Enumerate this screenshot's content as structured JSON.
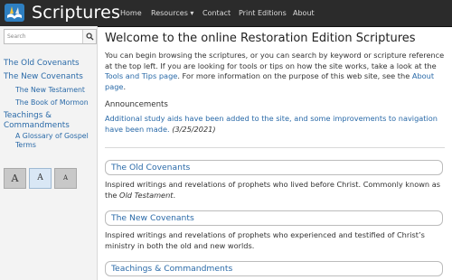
{
  "header": {
    "brand": "Scriptures",
    "nav": [
      "Home",
      "Resources ▾",
      "Contact",
      "Print Editions",
      "About"
    ]
  },
  "sidebar": {
    "search_placeholder": "Search",
    "items": [
      {
        "label": "The Old Covenants"
      },
      {
        "label": "The New Covenants"
      },
      {
        "label": "The New Testament"
      },
      {
        "label": "The Book of Mormon"
      },
      {
        "label": "Teachings & Commandments"
      },
      {
        "label": "A Glossary of Gospel Terms"
      }
    ],
    "font_sizes": [
      "A",
      "A",
      "A"
    ]
  },
  "main": {
    "title": "Welcome to the online Restoration Edition Scriptures",
    "intro_1": "You can begin browsing the scriptures, or you can search by keyword or scripture reference at the top left. If you are looking for tools or tips on how the site works, take a look at the",
    "tools_link": "Tools and Tips page",
    "intro_2": ". For more information on the purpose of this web site, see the",
    "about_link": "About page",
    "intro_3": ".",
    "announcements_title": "Announcements",
    "announcement_text": "Additional study aids have been added to the site, and some improvements to navigation have been made.",
    "announcement_date": "(3/25/2021)",
    "sections": [
      {
        "title": "The Old Covenants",
        "desc_1": "Inspired writings and revelations of prophets who lived before Christ. Commonly known as the ",
        "desc_italic": "Old Testament",
        "desc_2": "."
      },
      {
        "title": "The New Covenants",
        "desc_1": "Inspired writings and revelations of prophets who experienced and testified of Christ’s ministry in both the old and new worlds.",
        "desc_italic": "",
        "desc_2": ""
      },
      {
        "title": "Teachings & Commandments",
        "desc_1": "",
        "desc_italic": "",
        "desc_2": ""
      }
    ]
  },
  "colors": {
    "link": "#2a6aa8",
    "navbar": "#2b2b2b",
    "sidebar": "#f3f3f3"
  }
}
